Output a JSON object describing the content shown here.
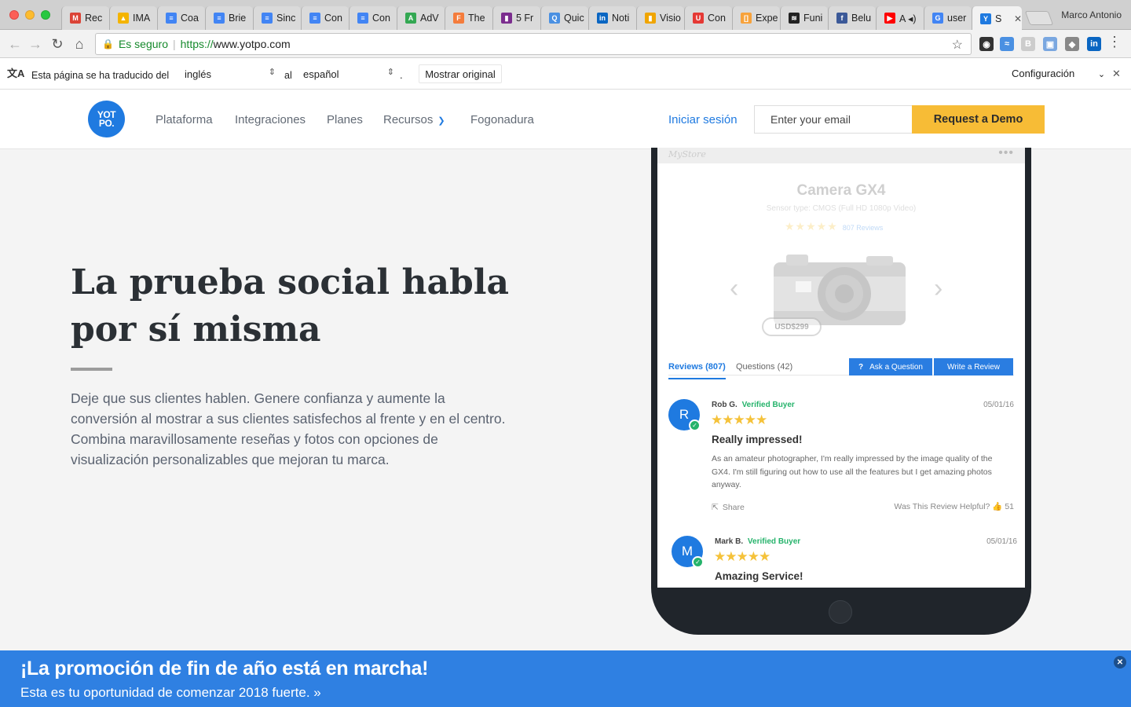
{
  "browser": {
    "tabs": [
      {
        "title": "Rec",
        "icon": "gmail-icon",
        "color": "#db4437",
        "glyph": "M"
      },
      {
        "title": "IMA",
        "icon": "drive-icon",
        "color": "#f4b400",
        "glyph": "▲"
      },
      {
        "title": "Coa",
        "icon": "docs-icon",
        "color": "#4285f4",
        "glyph": "≡"
      },
      {
        "title": "Brie",
        "icon": "docs-icon",
        "color": "#4285f4",
        "glyph": "≡"
      },
      {
        "title": "Sinc",
        "icon": "docs-icon",
        "color": "#4285f4",
        "glyph": "≡"
      },
      {
        "title": "Con",
        "icon": "docs-icon",
        "color": "#4285f4",
        "glyph": "≡"
      },
      {
        "title": "Con",
        "icon": "docs-icon",
        "color": "#4285f4",
        "glyph": "≡"
      },
      {
        "title": "AdV",
        "icon": "adwords-icon",
        "color": "#34a853",
        "glyph": "A"
      },
      {
        "title": "The",
        "icon": "f-icon",
        "color": "#f47c3c",
        "glyph": "F"
      },
      {
        "title": "5 Fr",
        "icon": "chart-icon",
        "color": "#7b2d8e",
        "glyph": "▮"
      },
      {
        "title": "Quic",
        "icon": "qa-icon",
        "color": "#4a90e2",
        "glyph": "Q"
      },
      {
        "title": "Noti",
        "icon": "linkedin-icon",
        "color": "#0a66c2",
        "glyph": "in"
      },
      {
        "title": "Visio",
        "icon": "bars-icon",
        "color": "#f0a500",
        "glyph": "▮"
      },
      {
        "title": "Con",
        "icon": "magnet-icon",
        "color": "#e53935",
        "glyph": "U"
      },
      {
        "title": "Expe",
        "icon": "bracket-icon",
        "color": "#f7a23b",
        "glyph": "[]"
      },
      {
        "title": "Funi",
        "icon": "spotify-icon",
        "color": "#222222",
        "glyph": "≋"
      },
      {
        "title": "Belu",
        "icon": "facebook-icon",
        "color": "#3b5998",
        "glyph": "f"
      },
      {
        "title": "A ◂)",
        "icon": "youtube-icon",
        "color": "#ff0000",
        "glyph": "▶"
      },
      {
        "title": "user",
        "icon": "google-icon",
        "color": "#4285f4",
        "glyph": "G"
      },
      {
        "title": "S",
        "icon": "yotpo-icon",
        "color": "#1f7ae0",
        "glyph": "Y"
      }
    ],
    "profile": "Marco Antonio",
    "secure_label": "Es seguro",
    "url_scheme": "https://",
    "url_host": "www.yotpo.com"
  },
  "translate": {
    "prefix": "Esta página se ha traducido del",
    "from": "inglés",
    "connector": "al",
    "to": "español",
    "dot": ".",
    "show_original": "Mostrar original",
    "config": "Configuración"
  },
  "header": {
    "logo_line1": "YOT",
    "logo_line2": "PO.",
    "nav": [
      "Plataforma",
      "Integraciones",
      "Planes",
      "Recursos",
      "Fogonadura"
    ],
    "login": "Iniciar sesión",
    "email_placeholder": "Enter your email",
    "demo": "Request a Demo"
  },
  "hero": {
    "title": "La prueba social habla por sí misma",
    "copy": "Deje que sus clientes hablen. Genere confianza y aumente la conversión al mostrar a sus clientes satisfechos al frente y en el centro. Combina maravillosamente reseñas y fotos con opciones de visualización personalizables que mejoran tu marca."
  },
  "phone": {
    "store": "MyStore",
    "product": "Camera GX4",
    "spec": "Sensor type: CMOS (Full HD 1080p Video)",
    "rating_count": "807 Reviews",
    "price": "USD$299",
    "tab_reviews": "Reviews (807)",
    "tab_questions": "Questions (42)",
    "ask": "Ask a Question",
    "write": "Write a Review",
    "reviews": [
      {
        "initial": "R",
        "name": "Rob G.",
        "verified": "Verified Buyer",
        "date": "05/01/16",
        "stars": 5,
        "headline": "Really impressed!",
        "body": "As an amateur photographer, I'm really impressed by the image quality of the GX4. I'm still figuring out how to use all the features but I get amazing photos anyway.",
        "share": "Share",
        "helpful": "Was This Review Helpful?",
        "helpful_count": "51"
      },
      {
        "initial": "M",
        "name": "Mark B.",
        "verified": "Verified Buyer",
        "date": "05/01/16",
        "stars": 5,
        "headline": "Amazing Service!"
      }
    ]
  },
  "promo": {
    "title": "¡La promoción de fin de año está en marcha!",
    "subtitle": "Esta es tu oportunidad de comenzar 2018 fuerte. »"
  },
  "colors": {
    "brand_blue": "#1f7ae0",
    "demo_yellow": "#f7bc36",
    "promo_blue": "#2f80e2",
    "verified_green": "#25b36b"
  }
}
